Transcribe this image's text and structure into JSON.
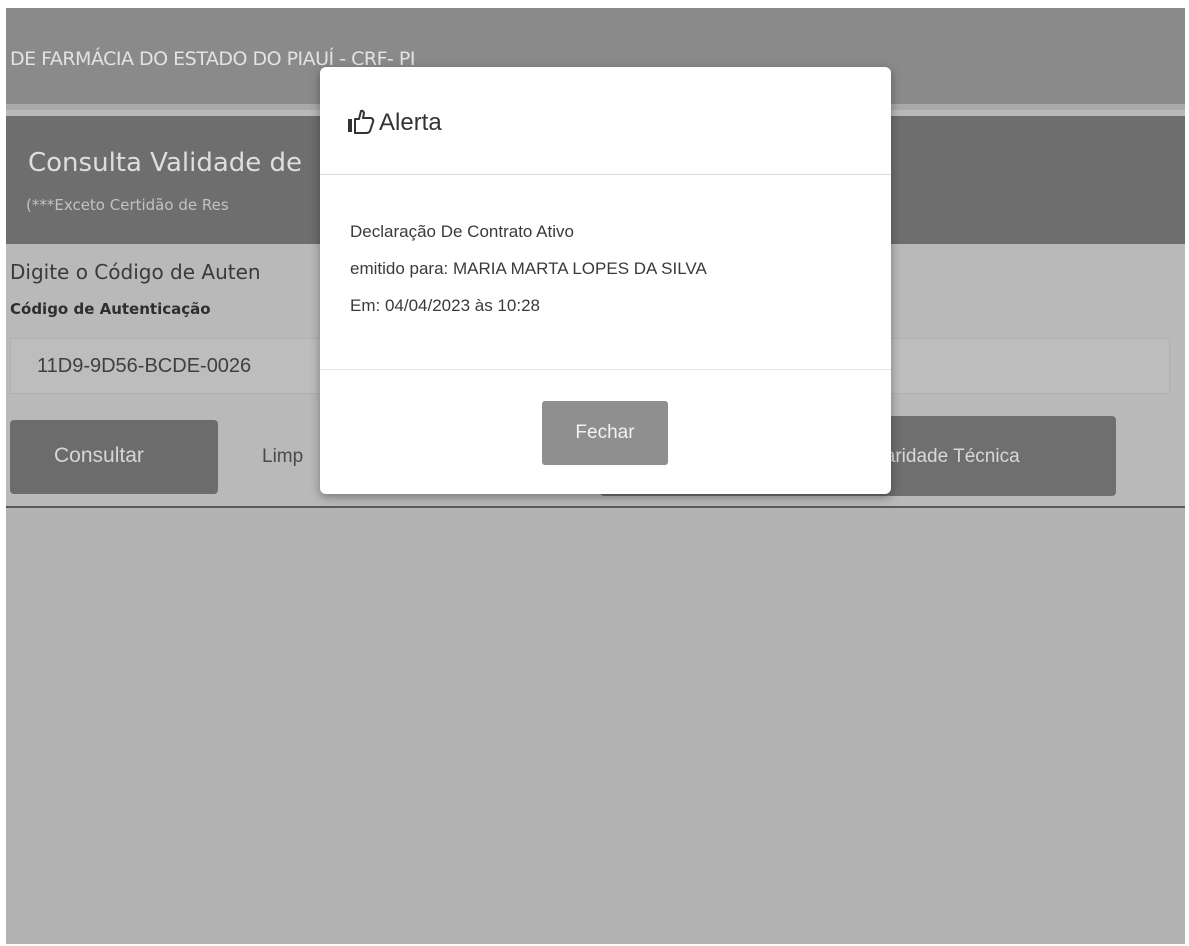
{
  "header": {
    "title": "DE FARMÁCIA DO ESTADO DO PIAUÍ - CRF- PI"
  },
  "consulta": {
    "title": "Consulta Validade de",
    "subtitle": "(***Exceto Certidão de Res"
  },
  "form": {
    "prompt": "Digite o Código de Auten",
    "code_label": "Código de Autenticação",
    "code_value": "11D9-9D56-BCDE-0026",
    "consultar_label": "Consultar",
    "limpar_label": "Limp",
    "regularidade_label": "ularidade Técnica"
  },
  "modal": {
    "icon": "thumbs-up-icon",
    "title": "Alerta",
    "lines": [
      "Declaração De Contrato Ativo",
      "emitido para: MARIA MARTA LOPES DA SILVA",
      "Em: 04/04/2023 às 10:28"
    ],
    "close_label": "Fechar"
  },
  "colors": {
    "overlay_gray": "#b9b9b9",
    "header_gray": "#8a8a8a",
    "panel_gray": "#6e6e6e",
    "button_gray": "#6c6c6c",
    "fechar_gray": "#8f8f8f"
  }
}
